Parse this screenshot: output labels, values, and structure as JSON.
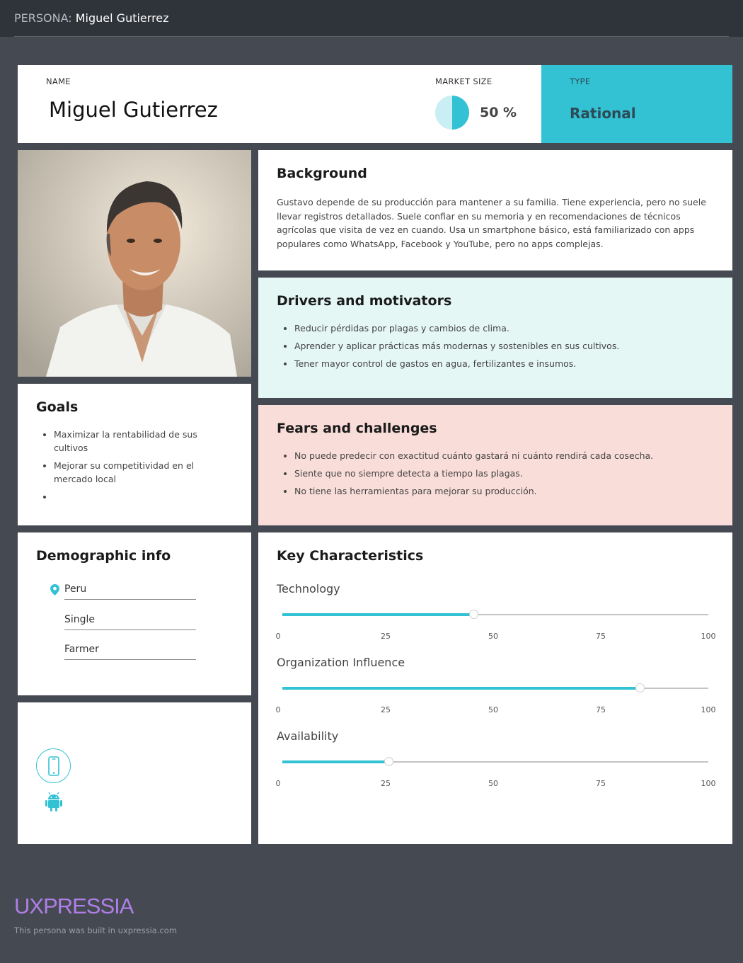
{
  "topbar": {
    "prefix": "PERSONA:",
    "name": "Miguel Gutierrez"
  },
  "header": {
    "name_label": "NAME",
    "name": "Miguel Gutierrez",
    "market_label": "MARKET SIZE",
    "market_percent": 50,
    "market_value": "50 %",
    "type_label": "TYPE",
    "type_value": "Rational"
  },
  "photo": {
    "subject": "portrait-photo"
  },
  "goals": {
    "title": "Goals",
    "items": [
      "Maximizar la rentabilidad de sus cultivos",
      "Mejorar su competitividad en el mercado local",
      ""
    ]
  },
  "demographic": {
    "title": "Demographic info",
    "location": "Peru",
    "status": "Single",
    "occupation": "Farmer"
  },
  "devices": {
    "icons": [
      "smartphone-icon",
      "android-icon"
    ]
  },
  "background": {
    "title": "Background",
    "text": "Gustavo depende de su producción para mantener a su familia. Tiene experiencia, pero no suele llevar registros detallados. Suele confiar en su memoria y en recomendaciones de técnicos agrícolas que visita de vez en cuando. Usa un smartphone básico, está familiarizado con apps populares como WhatsApp, Facebook y YouTube, pero no apps complejas."
  },
  "drivers": {
    "title": "Drivers and motivators",
    "items": [
      "Reducir pérdidas por plagas y cambios de clima.",
      "Aprender y aplicar prácticas más modernas y sostenibles en sus cultivos.",
      "Tener mayor control de gastos en agua, fertilizantes e insumos."
    ]
  },
  "fears": {
    "title": "Fears and challenges",
    "items": [
      "No puede predecir con exactitud cuánto gastará ni cuánto rendirá cada cosecha.",
      "Siente que no siempre detecta a tiempo las plagas.",
      "No tiene las herramientas para mejorar su producción."
    ]
  },
  "key_characteristics": {
    "title": "Key Characteristics",
    "ticks": [
      "0",
      "25",
      "50",
      "75",
      "100"
    ],
    "sliders": [
      {
        "label": "Technology",
        "value": 45
      },
      {
        "label": "Organization Influence",
        "value": 84
      },
      {
        "label": "Availability",
        "value": 25
      }
    ]
  },
  "colors": {
    "accent": "#33c2d4",
    "drivers_bg": "#e4f7f4",
    "fears_bg": "#f9ddd9",
    "logo": "#b07ee8"
  },
  "footer": {
    "logo": "UXPRESSIA",
    "note": "This persona was built in uxpressia.com"
  }
}
